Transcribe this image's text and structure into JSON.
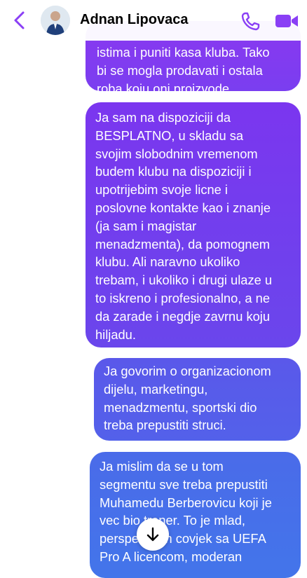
{
  "header": {
    "contact_name": "Adnan Lipovaca",
    "back_icon": "chevron-left-icon",
    "call_icon": "phone-icon",
    "video_icon": "video-camera-icon",
    "accent_color": "#8a3ff5"
  },
  "messages": [
    {
      "text": "istima i puniti kasa kluba. Tako\nbi se mogla prodavati i ostala\nroba koju oni proizvode."
    },
    {
      "text": "Ja sam na dispoziciji da\nBESPLATNO, u skladu sa\nsvojim slobodnim vremenom\nbudem klubu na dispoziciji i\nupotrijebim svoje licne i\nposlovne kontakte kao i znanje\n(ja sam i magistar\nmenadzmenta), da pomognem\nklubu. Ali naravno ukoliko\ntrebam, i ukoliko i drugi ulaze u\nto iskreno i profesionalno, a ne\nda zarade i negdje zavrnu koju\nhiljadu."
    },
    {
      "text": "Ja govorim o organizacionom\ndijelu, marketingu,\nmenadzmentu, sportski dio\ntreba prepustiti struci."
    },
    {
      "text": "Ja mislim da se u tom\nsegmentu sve treba prepustiti\nMuhamedu Berberovicu koji je\nvec bio trener. To je mlad,\nperspektivan covjek sa UEFA\nPro A licencom, moderan"
    }
  ],
  "scroll_down_icon": "arrow-down-icon"
}
